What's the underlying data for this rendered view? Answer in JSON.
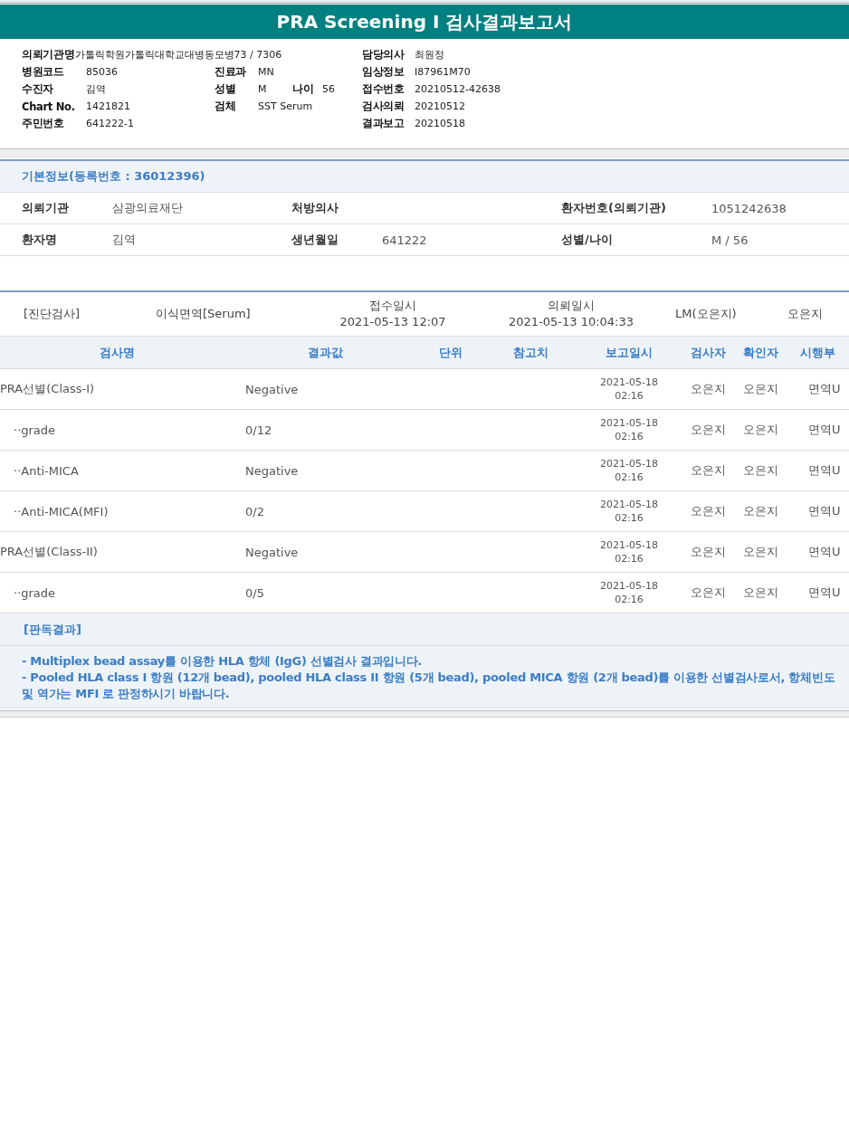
{
  "title": "PRA Screening I 검사결과보고서",
  "header_rows": [
    [
      {
        "label": "의뢰기관명",
        "value": "가톨릭학원가톨릭대학교대병동모병73 / 7306"
      },
      null,
      {
        "label": "담당의사",
        "value": "최원정"
      }
    ],
    [
      {
        "label": "병원코드",
        "value": "85036"
      },
      {
        "label": "진료과",
        "value": "MN"
      },
      {
        "label": "임상정보",
        "value": "I87961M70"
      }
    ],
    [
      {
        "label": "수진자",
        "value": "김역"
      },
      {
        "label": "성별",
        "value": "M",
        "extra_label": "나이",
        "extra_value": "56"
      },
      {
        "label": "접수번호",
        "value": "20210512-42638"
      }
    ],
    [
      {
        "label": "Chart No.",
        "value": "1421821"
      },
      {
        "label": "검체",
        "value": "SST Serum"
      },
      {
        "label": "검사의뢰",
        "value": "20210512"
      }
    ],
    [
      {
        "label": "주민번호",
        "value": "641222-1"
      },
      null,
      {
        "label": "결과보고",
        "value": "20210518"
      }
    ]
  ],
  "basic_info": {
    "title": "기본정보(등록번호 : 36012396)",
    "rows": [
      [
        {
          "label": "의뢰기관",
          "value": "삼광의료재단"
        },
        {
          "label": "처방의사"
        },
        {
          "label": "환자번호(의뢰기관)",
          "value": "1051242638"
        }
      ],
      [
        {
          "label": "환자명",
          "value": "김역"
        },
        {
          "label": "생년월일",
          "value": "641222"
        },
        {
          "label": "성별/나이",
          "value": "M / 56"
        }
      ]
    ]
  },
  "order": {
    "category": "[진단검사]",
    "test_group": "이식면역[Serum]",
    "received_label": "접수일시",
    "received": "2021-05-13  12:07",
    "requested_label": "의뢰일시",
    "requested": "2021-05-13  10:04:33",
    "lab": "LM(오은지)",
    "person": "오은지"
  },
  "results": {
    "columns": [
      "검사명",
      "결과값",
      "단위",
      "참고치",
      "보고일시",
      "검사자",
      "확인자",
      "시행부"
    ],
    "rows": [
      {
        "name": "PRA선별(Class-I)",
        "result": "Negative",
        "date": "2021-05-18",
        "time": "02:16",
        "tester": "오은지",
        "confirmer": "오은지",
        "dept": "면역U",
        "children": [
          {
            "name": "··grade",
            "result": "0/12",
            "date": "2021-05-18",
            "time": "02:16",
            "tester": "오은지",
            "confirmer": "오은지",
            "dept": "면역U"
          },
          {
            "name": "··Anti-MICA",
            "result": "Negative",
            "date": "2021-05-18",
            "time": "02:16",
            "tester": "오은지",
            "confirmer": "오은지",
            "dept": "면역U"
          },
          {
            "name": "··Anti-MICA(MFI)",
            "result": "0/2",
            "date": "2021-05-18",
            "time": "02:16",
            "tester": "오은지",
            "confirmer": "오은지",
            "dept": "면역U"
          }
        ]
      },
      {
        "name": "PRA선별(Class-II)",
        "result": "Negative",
        "date": "2021-05-18",
        "time": "02:16",
        "tester": "오은지",
        "confirmer": "오은지",
        "dept": "면역U",
        "children": [
          {
            "name": "··grade",
            "result": "0/5",
            "date": "2021-05-18",
            "time": "02:16",
            "tester": "오은지",
            "confirmer": "오은지",
            "dept": "면역U"
          }
        ]
      }
    ]
  },
  "interpretation": {
    "title": "[판독결과]",
    "lines": [
      "- Multiplex bead assay를 이용한 HLA 항체 (IgG) 선별검사 결과입니다.",
      "- Pooled HLA class I 항원 (12개 bead), pooled HLA class II 항원 (5개 bead), pooled MICA 항원 (2개 bead)를 이용한 선별검사로서, 항체빈도 및 역가는 MFI 로 판정하시기 바랍니다."
    ]
  }
}
